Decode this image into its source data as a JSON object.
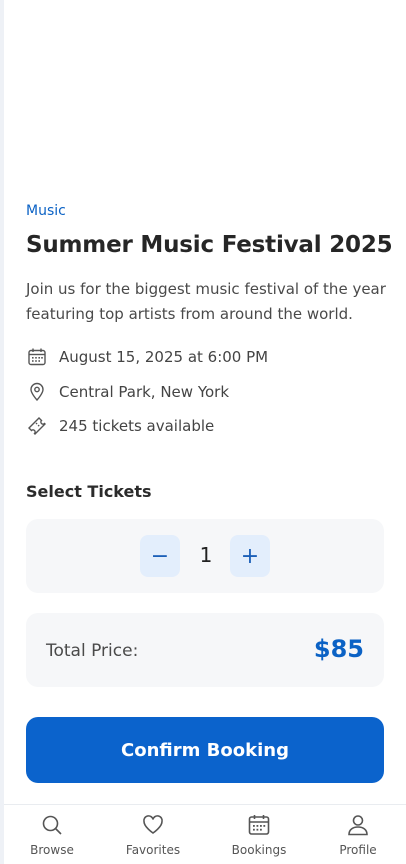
{
  "event": {
    "category": "Music",
    "title": "Summer Music Festival 2025",
    "description": "Join us for the biggest music festival of the year featuring top artists from around the world.",
    "date_time": "August 15, 2025 at 6:00 PM",
    "location": "Central Park, New York",
    "availability": "245 tickets available"
  },
  "tickets": {
    "section_title": "Select Tickets",
    "minus_label": "−",
    "plus_label": "+",
    "quantity": "1"
  },
  "total": {
    "label": "Total Price:",
    "value": "$85"
  },
  "actions": {
    "confirm_label": "Confirm Booking"
  },
  "tabbar": {
    "items": [
      {
        "label": "Browse",
        "icon": "search-icon"
      },
      {
        "label": "Favorites",
        "icon": "heart-icon"
      },
      {
        "label": "Bookings",
        "icon": "calendar-icon"
      },
      {
        "label": "Profile",
        "icon": "user-icon"
      }
    ]
  },
  "colors": {
    "accent": "#0b63cc",
    "accent_text": "#0b62c5",
    "stepper_bg": "#e3eefc",
    "card_bg": "#f6f7f9"
  }
}
